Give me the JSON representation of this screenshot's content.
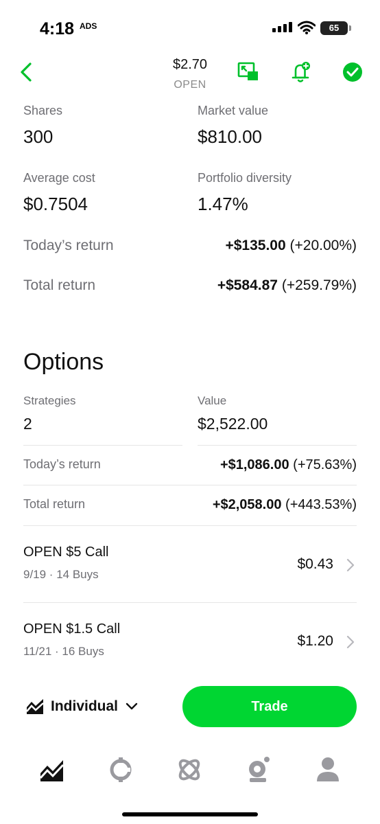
{
  "status_bar": {
    "time": "4:18",
    "time_badge": "ADS",
    "battery": "65"
  },
  "header": {
    "price": "$2.70",
    "ticker": "OPEN"
  },
  "colors": {
    "accent": "#00d632",
    "muted": "#6e6e73"
  },
  "position": {
    "shares_label": "Shares",
    "shares_value": "300",
    "market_value_label": "Market value",
    "market_value": "$810.00",
    "avg_cost_label": "Average cost",
    "avg_cost": "$0.7504",
    "diversity_label": "Portfolio diversity",
    "diversity": "1.47%",
    "today_label": "Today’s return",
    "today_amount": "+$135.00",
    "today_pct": "(+20.00%)",
    "total_label": "Total return",
    "total_amount": "+$584.87",
    "total_pct": "(+259.79%)"
  },
  "options": {
    "title": "Options",
    "strategies_label": "Strategies",
    "strategies_value": "2",
    "value_label": "Value",
    "value": "$2,522.00",
    "today_label": "Today’s return",
    "today_amount": "+$1,086.00",
    "today_pct": "(+75.63%)",
    "total_label": "Total return",
    "total_amount": "+$2,058.00",
    "total_pct": "(+443.53%)",
    "contracts": [
      {
        "name": "OPEN $5 Call",
        "details": "9/19 · 14 Buys",
        "price": "$0.43"
      },
      {
        "name": "OPEN $1.5 Call",
        "details": "11/21 · 16 Buys",
        "price": "$1.20"
      }
    ]
  },
  "account": {
    "label": "Individual"
  },
  "trade_button": {
    "label": "Trade"
  },
  "tabs": [
    "investing-icon",
    "crypto-icon",
    "explore-icon",
    "notifications-icon",
    "profile-icon"
  ]
}
